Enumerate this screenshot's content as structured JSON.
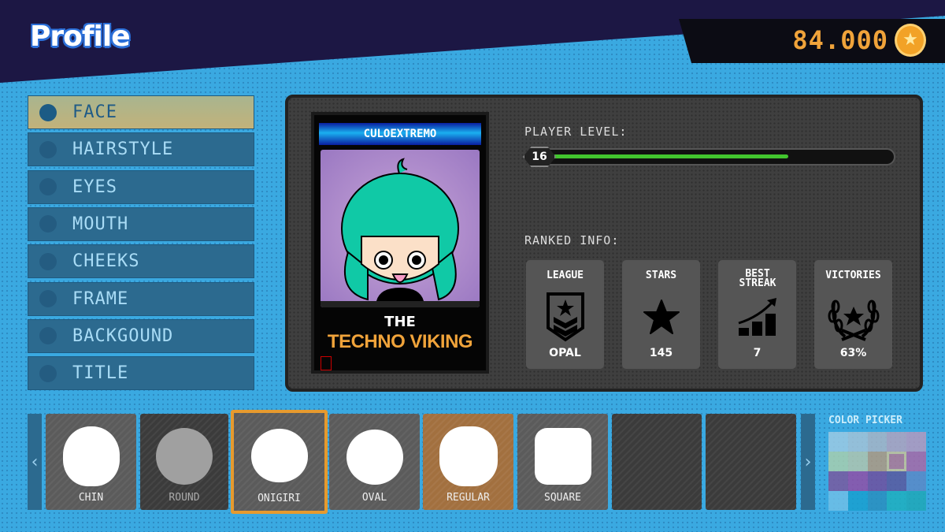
{
  "header": {
    "title": "Profile",
    "coins": "84.000",
    "coin_icon": "star-coin-icon"
  },
  "sidebar": {
    "items": [
      {
        "label": "FACE",
        "selected": true
      },
      {
        "label": "HAIRSTYLE"
      },
      {
        "label": "EYES"
      },
      {
        "label": "MOUTH"
      },
      {
        "label": "CHEEKS"
      },
      {
        "label": "FRAME"
      },
      {
        "label": "BACKGOUND"
      },
      {
        "label": "TITLE"
      }
    ]
  },
  "card": {
    "player_name": "CULOEXTREMO",
    "title_prefix": "THE",
    "title": "TECHNO VIKING"
  },
  "player": {
    "level_label": "PLAYER LEVEL:",
    "level": "16",
    "progress": 0.72
  },
  "ranked": {
    "label": "RANKED INFO:",
    "stats": [
      {
        "label": "LEAGUE",
        "value": "OPAL",
        "icon": "league-badge-icon"
      },
      {
        "label": "STARS",
        "value": "145",
        "icon": "star-icon"
      },
      {
        "label": "BEST STREAK",
        "value": "7",
        "icon": "streak-chart-icon"
      },
      {
        "label": "VICTORIES",
        "value": "63%",
        "icon": "laurel-icon"
      }
    ]
  },
  "faces": [
    {
      "label": "CHIN"
    },
    {
      "label": "ROUND",
      "locked": true
    },
    {
      "label": "ONIGIRI",
      "selected": true
    },
    {
      "label": "OVAL"
    },
    {
      "label": "REGULAR",
      "equipped": true
    },
    {
      "label": "SQUARE"
    },
    {
      "label": ""
    },
    {
      "label": ""
    }
  ],
  "color_picker": {
    "label": "COLOR PICKER",
    "colors": [
      "#9ccbe4",
      "#a3c4d8",
      "#a7b5c6",
      "#b0a4c0",
      "#b49ac0",
      "#a8cfb0",
      "#b0c6b0",
      "#b09a82",
      "#b07a96",
      "#a86aa8",
      "#7a5aa0",
      "#9050a8",
      "#7050a0",
      "#5a5aa0",
      "#5a8ac8",
      "#70c0e8",
      "#1aa0d0",
      "#2a90c0",
      "#20b0c0",
      "#20a8b8"
    ],
    "selected_index": 8
  }
}
